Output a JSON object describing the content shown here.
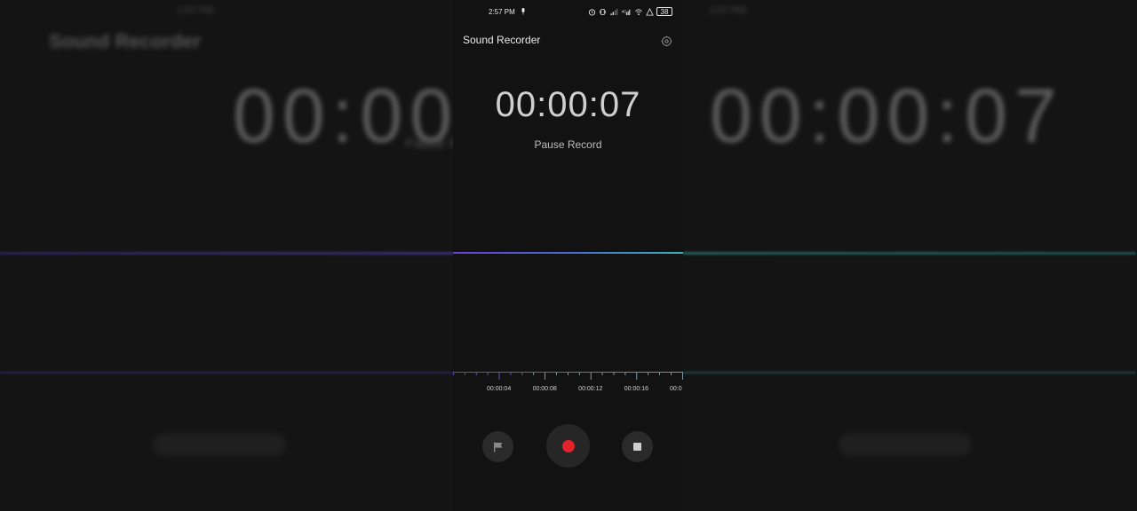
{
  "app": {
    "title": "Sound Recorder"
  },
  "statusbar": {
    "time": "2:57 PM",
    "battery": "38"
  },
  "recorder": {
    "elapsed": "00:00:07",
    "status": "Pause Record"
  },
  "ruler": {
    "labels": [
      "00:00:04",
      "00:00:08",
      "00:00:12",
      "00:00:16",
      "00:0"
    ]
  },
  "icons": {
    "settings": "settings-icon",
    "flag": "flag-icon",
    "record": "record-icon",
    "stop": "stop-icon",
    "mic": "mic-icon",
    "alarm": "alarm-icon",
    "signal": "signal-icon",
    "wifi": "wifi-icon"
  },
  "colors": {
    "record": "#e3222a",
    "wave_start": "#6a3fd6",
    "wave_end": "#38b5b5",
    "background": "#121212"
  }
}
